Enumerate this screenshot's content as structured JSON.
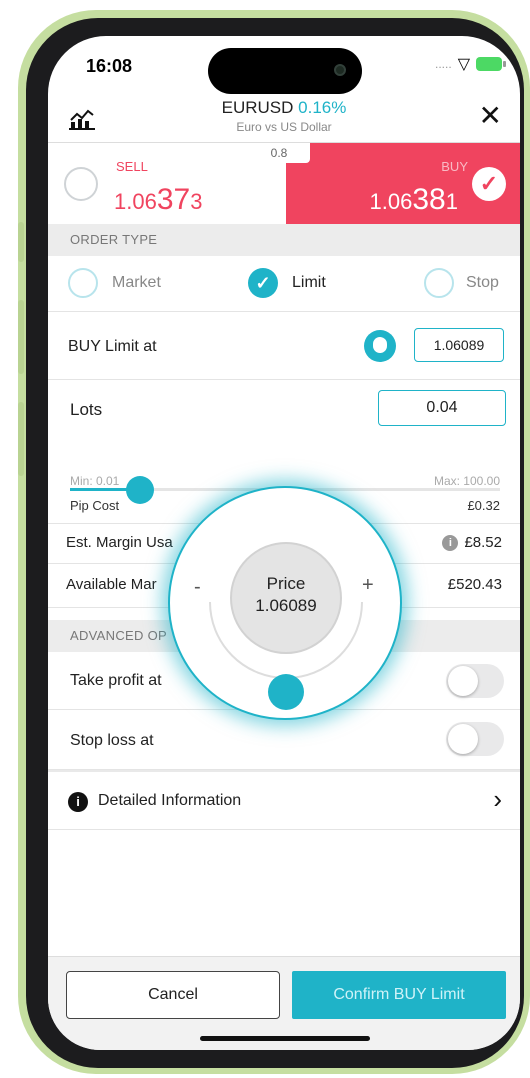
{
  "status": {
    "time": "16:08",
    "signal": "....."
  },
  "header": {
    "symbol": "EURUSD",
    "change": "0.16%",
    "subtitle": "Euro vs US Dollar"
  },
  "quote": {
    "spread": "0.8",
    "sell": {
      "label": "SELL",
      "price_prefix": "1.06",
      "price_big": "37",
      "price_suffix": "3"
    },
    "buy": {
      "label": "BUY",
      "price_prefix": "1.06",
      "price_big": "38",
      "price_suffix": "1"
    }
  },
  "order_type": {
    "heading": "ORDER TYPE",
    "options": [
      "Market",
      "Limit",
      "Stop"
    ],
    "selected": "Limit"
  },
  "limit": {
    "label": "BUY Limit at",
    "value": "1.06089"
  },
  "lots": {
    "label": "Lots",
    "value": "0.04",
    "min": "Min: 0.01",
    "max": "Max: 100.00",
    "slider_fraction": 0.04
  },
  "pip_cost": {
    "label": "Pip Cost",
    "value": "£0.32"
  },
  "margin": {
    "label": "Est. Margin Usa",
    "value": "£8.52"
  },
  "available": {
    "label": "Available Mar",
    "value": "£520.43"
  },
  "advanced": {
    "heading": "ADVANCED OP"
  },
  "take_profit": {
    "label": "Take profit at"
  },
  "stop_loss": {
    "label": "Stop loss at"
  },
  "details": {
    "label": "Detailed Information"
  },
  "dial": {
    "label": "Price",
    "value": "1.06089",
    "minus": "-",
    "plus": "+"
  },
  "footer": {
    "cancel": "Cancel",
    "confirm": "Confirm BUY Limit"
  },
  "colors": {
    "accent": "#1fb3c8",
    "buy": "#f0445f",
    "frame": "#c5dea0"
  }
}
